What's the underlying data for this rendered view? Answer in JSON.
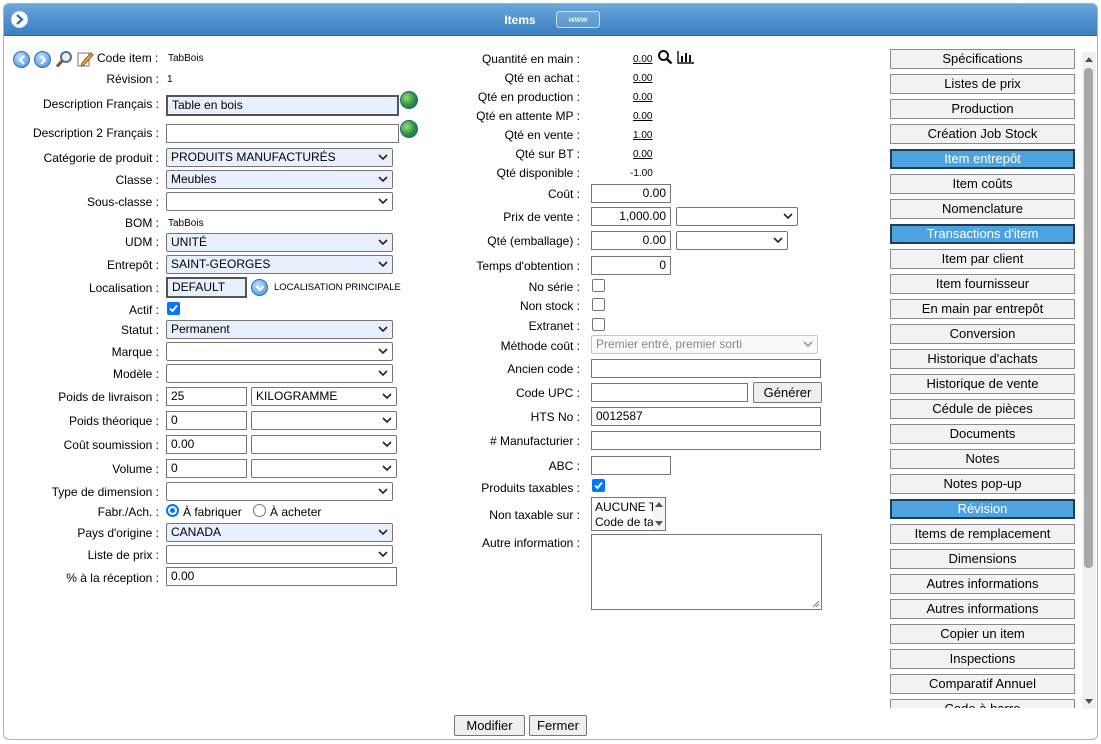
{
  "window": {
    "title": "Items",
    "www_badge": "www"
  },
  "left": {
    "code_item_label": "Code item :",
    "code_item_value": "TabBois",
    "revision_label": "Révision :",
    "revision_value": "1",
    "desc_fr_label": "Description Français :",
    "desc_fr_value": "Table en bois",
    "desc2_fr_label": "Description 2 Français :",
    "desc2_fr_value": "",
    "categorie_label": "Catégorie de produit :",
    "categorie_value": "PRODUITS MANUFACTURÉS",
    "classe_label": "Classe :",
    "classe_value": "Meubles",
    "sousclasse_label": "Sous-classe :",
    "sousclasse_value": "",
    "bom_label": "BOM :",
    "bom_value": "TabBois",
    "udm_label": "UDM :",
    "udm_value": "UNITÉ",
    "entrepot_label": "Entrepôt :",
    "entrepot_value": "SAINT-GEORGES",
    "localisation_label": "Localisation :",
    "localisation_value": "DEFAULT",
    "localisation_principale": "LOCALISATION PRINCIPALE",
    "actif_label": "Actif :",
    "statut_label": "Statut :",
    "statut_value": "Permanent",
    "marque_label": "Marque :",
    "marque_value": "",
    "modele_label": "Modèle :",
    "modele_value": "",
    "poids_liv_label": "Poids de livraison :",
    "poids_liv_value": "25",
    "poids_liv_unit": "KILOGRAMME",
    "poids_theo_label": "Poids théorique :",
    "poids_theo_value": "0",
    "poids_theo_unit": "",
    "cout_soum_label": "Coût soumission :",
    "cout_soum_value": "0.00",
    "cout_soum_unit": "",
    "volume_label": "Volume :",
    "volume_value": "0",
    "volume_unit": "",
    "type_dim_label": "Type de dimension :",
    "type_dim_value": "",
    "fabr_label": "Fabr./Ach. :",
    "fabr_opt1": "À fabriquer",
    "fabr_opt2": "À acheter",
    "pays_label": "Pays d'origine :",
    "pays_value": "CANADA",
    "liste_prix_label": "Liste de prix :",
    "liste_prix_value": "",
    "pct_reception_label": "% à la réception :",
    "pct_reception_value": "0.00"
  },
  "middle": {
    "qte_main_label": "Quantité en main :",
    "qte_main_value": "0.00",
    "qte_achat_label": "Qté en achat :",
    "qte_achat_value": "0.00",
    "qte_prod_label": "Qté en production :",
    "qte_prod_value": "0.00",
    "qte_attente_label": "Qté en attente MP :",
    "qte_attente_value": "0.00",
    "qte_vente_label": "Qté en vente :",
    "qte_vente_value": "1.00",
    "qte_bt_label": "Qté sur BT :",
    "qte_bt_value": "0.00",
    "qte_dispo_label": "Qté disponible :",
    "qte_dispo_value": "-1.00",
    "cout_label": "Coût :",
    "cout_value": "0.00",
    "prix_vente_label": "Prix de vente :",
    "prix_vente_value": "1,000.00",
    "prix_vente_sel": "",
    "qte_emb_label": "Qté (emballage) :",
    "qte_emb_value": "0.00",
    "qte_emb_sel": "",
    "temps_label": "Temps d'obtention :",
    "temps_value": "0",
    "no_serie_label": "No série :",
    "non_stock_label": "Non stock :",
    "extranet_label": "Extranet :",
    "methode_label": "Méthode coût :",
    "methode_value": "Premier entré, premier sorti",
    "ancien_code_label": "Ancien code :",
    "ancien_code_value": "",
    "upc_label": "Code UPC :",
    "upc_value": "",
    "generer_label": "Générer",
    "hts_label": "HTS No :",
    "hts_value": "0012587",
    "manufacturier_label": "# Manufacturier :",
    "manufacturier_value": "",
    "abc_label": "ABC :",
    "abc_value": "",
    "taxables_label": "Produits taxables :",
    "non_taxable_label": "Non taxable sur :",
    "non_taxable_options": [
      "AUCUNE T",
      "Code de ta"
    ],
    "autre_info_label": "Autre information :"
  },
  "right_buttons": [
    {
      "label": "Spécifications",
      "active": false
    },
    {
      "label": "Listes de prix",
      "active": false
    },
    {
      "label": "Production",
      "active": false
    },
    {
      "label": "Création Job Stock",
      "active": false
    },
    {
      "label": "Item entrepôt",
      "active": true
    },
    {
      "label": "Item coûts",
      "active": false
    },
    {
      "label": "Nomenclature",
      "active": false
    },
    {
      "label": "Transactions d'item",
      "active": true
    },
    {
      "label": "Item par client",
      "active": false
    },
    {
      "label": "Item fournisseur",
      "active": false
    },
    {
      "label": "En main par entrepôt",
      "active": false
    },
    {
      "label": "Conversion",
      "active": false
    },
    {
      "label": "Historique d'achats",
      "active": false
    },
    {
      "label": "Historique de vente",
      "active": false
    },
    {
      "label": "Cédule de pièces",
      "active": false
    },
    {
      "label": "Documents",
      "active": false
    },
    {
      "label": "Notes",
      "active": false
    },
    {
      "label": "Notes pop-up",
      "active": false
    },
    {
      "label": "Révision",
      "active": true
    },
    {
      "label": "Items de remplacement",
      "active": false
    },
    {
      "label": "Dimensions",
      "active": false
    },
    {
      "label": "Autres informations",
      "active": false
    },
    {
      "label": "Autres informations",
      "active": false
    },
    {
      "label": "Copier un item",
      "active": false
    },
    {
      "label": "Inspections",
      "active": false
    },
    {
      "label": "Comparatif Annuel",
      "active": false
    },
    {
      "label": "Code à barre",
      "active": false
    }
  ],
  "footer": {
    "modifier_label": "Modifier",
    "fermer_label": "Fermer"
  },
  "colors": {
    "title_bar": "#3a7fc2",
    "active_button": "#4da3e0",
    "field_highlight": "#e8f0fe",
    "checkbox": "#0075ff"
  }
}
